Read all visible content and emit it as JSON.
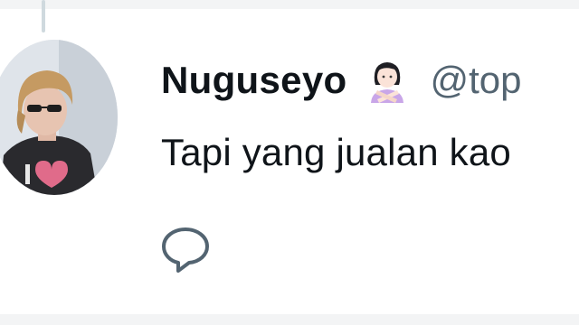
{
  "tweet": {
    "display_name": "Nuguseyo",
    "handle": "@top",
    "text": "Tapi yang jualan kao",
    "name_emoji_icon": "person-gesturing-no-icon",
    "avatar_icon": "profile-photo-avatar"
  },
  "actions": {
    "reply_icon": "reply-bubble-icon"
  },
  "colors": {
    "text_primary": "#0f1419",
    "text_secondary": "#536471",
    "thread_line": "#cfd9de",
    "background": "#ffffff"
  }
}
